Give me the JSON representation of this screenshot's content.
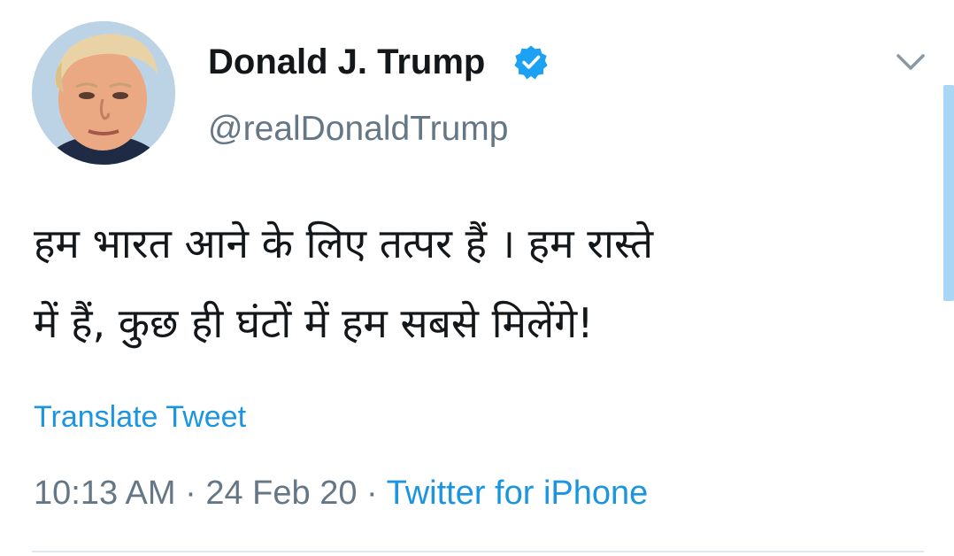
{
  "user": {
    "display_name": "Donald J. Trump",
    "handle": "@realDonaldTrump",
    "verified_icon": "verified-badge-icon",
    "avatar": "profile-photo"
  },
  "tweet": {
    "text_line1": "हम भारत आने के लिए तत्पर हैं । हम रास्ते",
    "text_line2": "में हैं, कुछ ही घंटों में हम सबसे मिलेंगे!",
    "translate_label": "Translate Tweet",
    "time": "10:13 AM",
    "separator": "·",
    "date": "24 Feb 20",
    "source": "Twitter for iPhone"
  },
  "icons": {
    "menu": "chevron-down-icon"
  },
  "colors": {
    "link": "#1b95e0",
    "verified": "#1da1f2",
    "secondary_text": "#657786",
    "primary_text": "#14171a",
    "divider": "#e1e8ed"
  }
}
